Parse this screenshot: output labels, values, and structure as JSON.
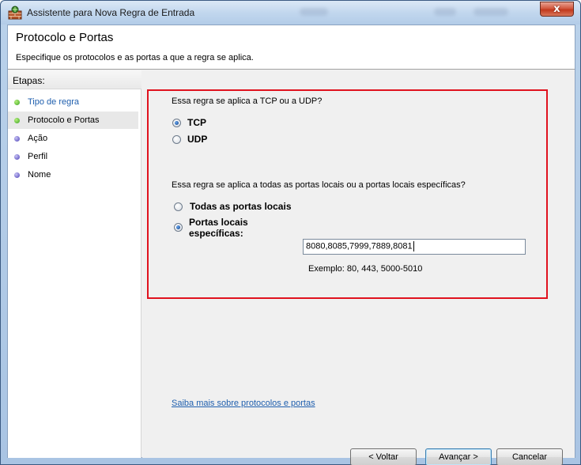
{
  "window": {
    "title": "Assistente para Nova Regra de Entrada",
    "close_label": "x"
  },
  "header": {
    "title": "Protocolo e Portas",
    "description": "Especifique os protocolos e as portas a que a regra se aplica."
  },
  "steps": {
    "title": "Etapas:",
    "items": [
      {
        "label": "Tipo de regra",
        "status": "done"
      },
      {
        "label": "Protocolo e Portas",
        "status": "current"
      },
      {
        "label": "Ação",
        "status": "pending"
      },
      {
        "label": "Perfil",
        "status": "pending"
      },
      {
        "label": "Nome",
        "status": "pending"
      }
    ]
  },
  "protocol": {
    "question": "Essa regra se aplica a TCP ou a UDP?",
    "tcp_label": "TCP",
    "udp_label": "UDP",
    "selected": "TCP"
  },
  "ports": {
    "question": "Essa regra se aplica a todas as portas locais ou a portas locais específicas?",
    "all_label": "Todas as portas locais",
    "specific_label_line1": "Portas locais",
    "specific_label_line2": "específicas:",
    "selected": "specific",
    "value": "8080,8085,7999,7889,8081",
    "example": "Exemplo: 80, 443, 5000-5010"
  },
  "learn_more": "Saiba mais sobre protocolos e portas",
  "buttons": {
    "back": "< Voltar",
    "next": "Avançar >",
    "cancel": "Cancelar"
  },
  "colors": {
    "highlight_border": "#e0121e",
    "link": "#1f5fae",
    "step_done_dot": "#3aa224",
    "step_pending_dot": "#4a3fb7"
  }
}
